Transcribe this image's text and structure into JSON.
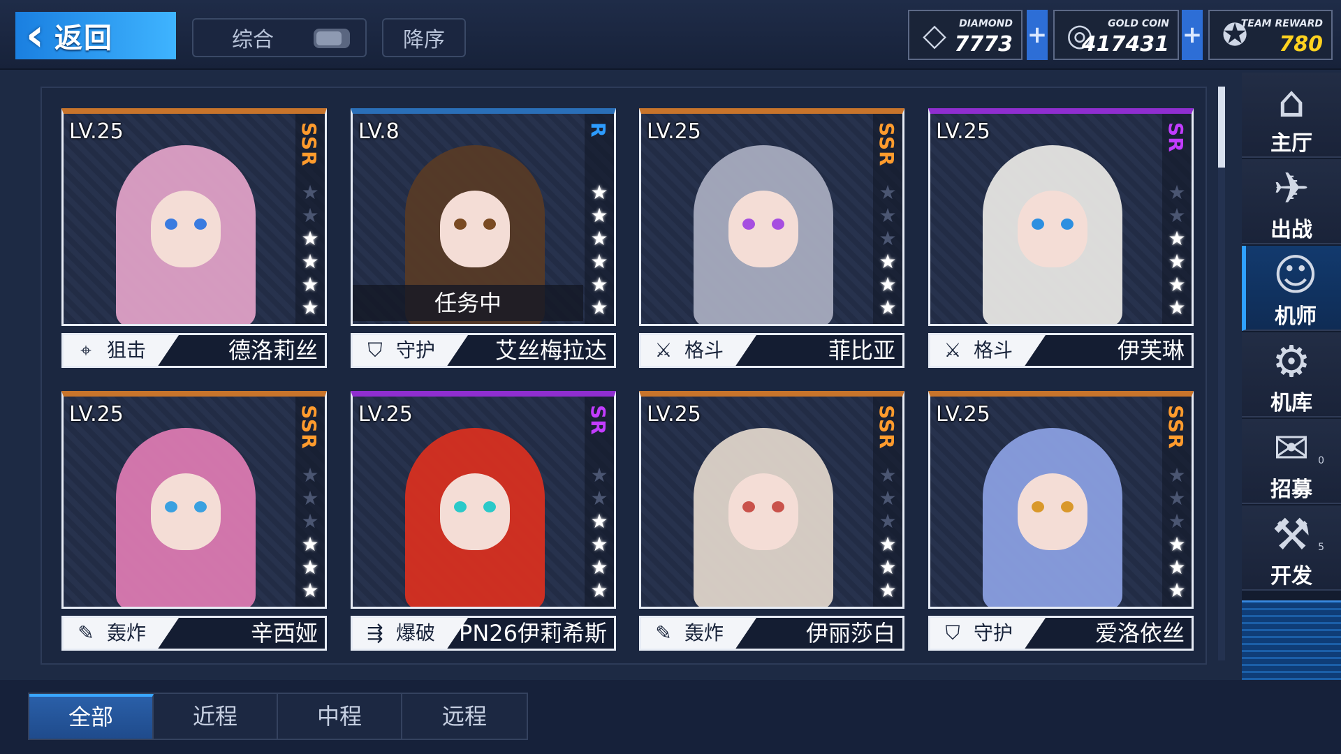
{
  "topbar": {
    "back_label": "返回",
    "sort_label": "综合",
    "order_label": "降序"
  },
  "resources": {
    "diamond": {
      "label": "DIAMOND",
      "value": "7773",
      "icon": "diamond-icon"
    },
    "gold": {
      "label": "GOLD COIN",
      "value": "417431",
      "icon": "coin-icon"
    },
    "team": {
      "label": "TEAM REWARD",
      "value": "780",
      "icon": "team-reward-icon",
      "color": "#ffd21f"
    }
  },
  "cards": [
    {
      "level": "LV.25",
      "rarity": "SSR",
      "stars": 4,
      "role": "狙击",
      "role_icon": "sniper-icon",
      "name": "德洛莉丝",
      "hair": "#e9a6cc",
      "eyes": "#3a7be0",
      "rarity_color": "#ff9b2d",
      "top_color": "#c8742b"
    },
    {
      "level": "LV.8",
      "rarity": "R",
      "stars": 6,
      "role": "守护",
      "role_icon": "shield-icon",
      "name": "艾丝梅拉达",
      "hair": "#5a3b25",
      "eyes": "#7a4a22",
      "rarity_color": "#2d9cff",
      "top_color": "#2a6fb8",
      "status": "任务中"
    },
    {
      "level": "LV.25",
      "rarity": "SSR",
      "stars": 3,
      "role": "格斗",
      "role_icon": "crossed-swords-icon",
      "name": "菲比亚",
      "hair": "#aeb1c4",
      "eyes": "#a64ee0",
      "rarity_color": "#ff9b2d",
      "top_color": "#c8742b"
    },
    {
      "level": "LV.25",
      "rarity": "SR",
      "stars": 4,
      "role": "格斗",
      "role_icon": "crossed-swords-icon",
      "name": "伊芙琳",
      "hair": "#f1eeea",
      "eyes": "#2d8fe0",
      "rarity_color": "#c23cff",
      "top_color": "#8f2ed0"
    },
    {
      "level": "LV.25",
      "rarity": "SSR",
      "stars": 3,
      "role": "轰炸",
      "role_icon": "bomber-icon",
      "name": "辛西娅",
      "hair": "#e47db6",
      "eyes": "#3aa0e0",
      "rarity_color": "#ff9b2d",
      "top_color": "#c8742b"
    },
    {
      "level": "LV.25",
      "rarity": "SR",
      "stars": 4,
      "role": "爆破",
      "role_icon": "blaster-icon",
      "name": "PN26伊莉希斯",
      "hair": "#e0301e",
      "eyes": "#2bc9c9",
      "rarity_color": "#c23cff",
      "top_color": "#8f2ed0"
    },
    {
      "level": "LV.25",
      "rarity": "SSR",
      "stars": 3,
      "role": "轰炸",
      "role_icon": "bomber-icon",
      "name": "伊丽莎白",
      "hair": "#e8dccf",
      "eyes": "#c9524b",
      "rarity_color": "#ff9b2d",
      "top_color": "#c8742b"
    },
    {
      "level": "LV.25",
      "rarity": "SSR",
      "stars": 3,
      "role": "守护",
      "role_icon": "shield-icon",
      "name": "爱洛依丝",
      "hair": "#8fa4e8",
      "eyes": "#d9982b",
      "rarity_color": "#ff9b2d",
      "top_color": "#c8742b"
    }
  ],
  "sidebar": {
    "items": [
      {
        "label": "主厅",
        "icon": "hall-icon",
        "glyph": "⌂"
      },
      {
        "label": "出战",
        "icon": "sortie-icon",
        "glyph": "✈"
      },
      {
        "label": "机师",
        "icon": "pilot-icon",
        "glyph": "☺",
        "active": true
      },
      {
        "label": "机库",
        "icon": "hangar-icon",
        "glyph": "⚙"
      },
      {
        "label": "招募",
        "icon": "recruit-icon",
        "glyph": "✉",
        "badge": "0"
      },
      {
        "label": "开发",
        "icon": "develop-icon",
        "glyph": "⚒",
        "badge": "5"
      }
    ]
  },
  "tabs": [
    {
      "label": "全部",
      "active": true
    },
    {
      "label": "近程"
    },
    {
      "label": "中程"
    },
    {
      "label": "远程"
    }
  ]
}
